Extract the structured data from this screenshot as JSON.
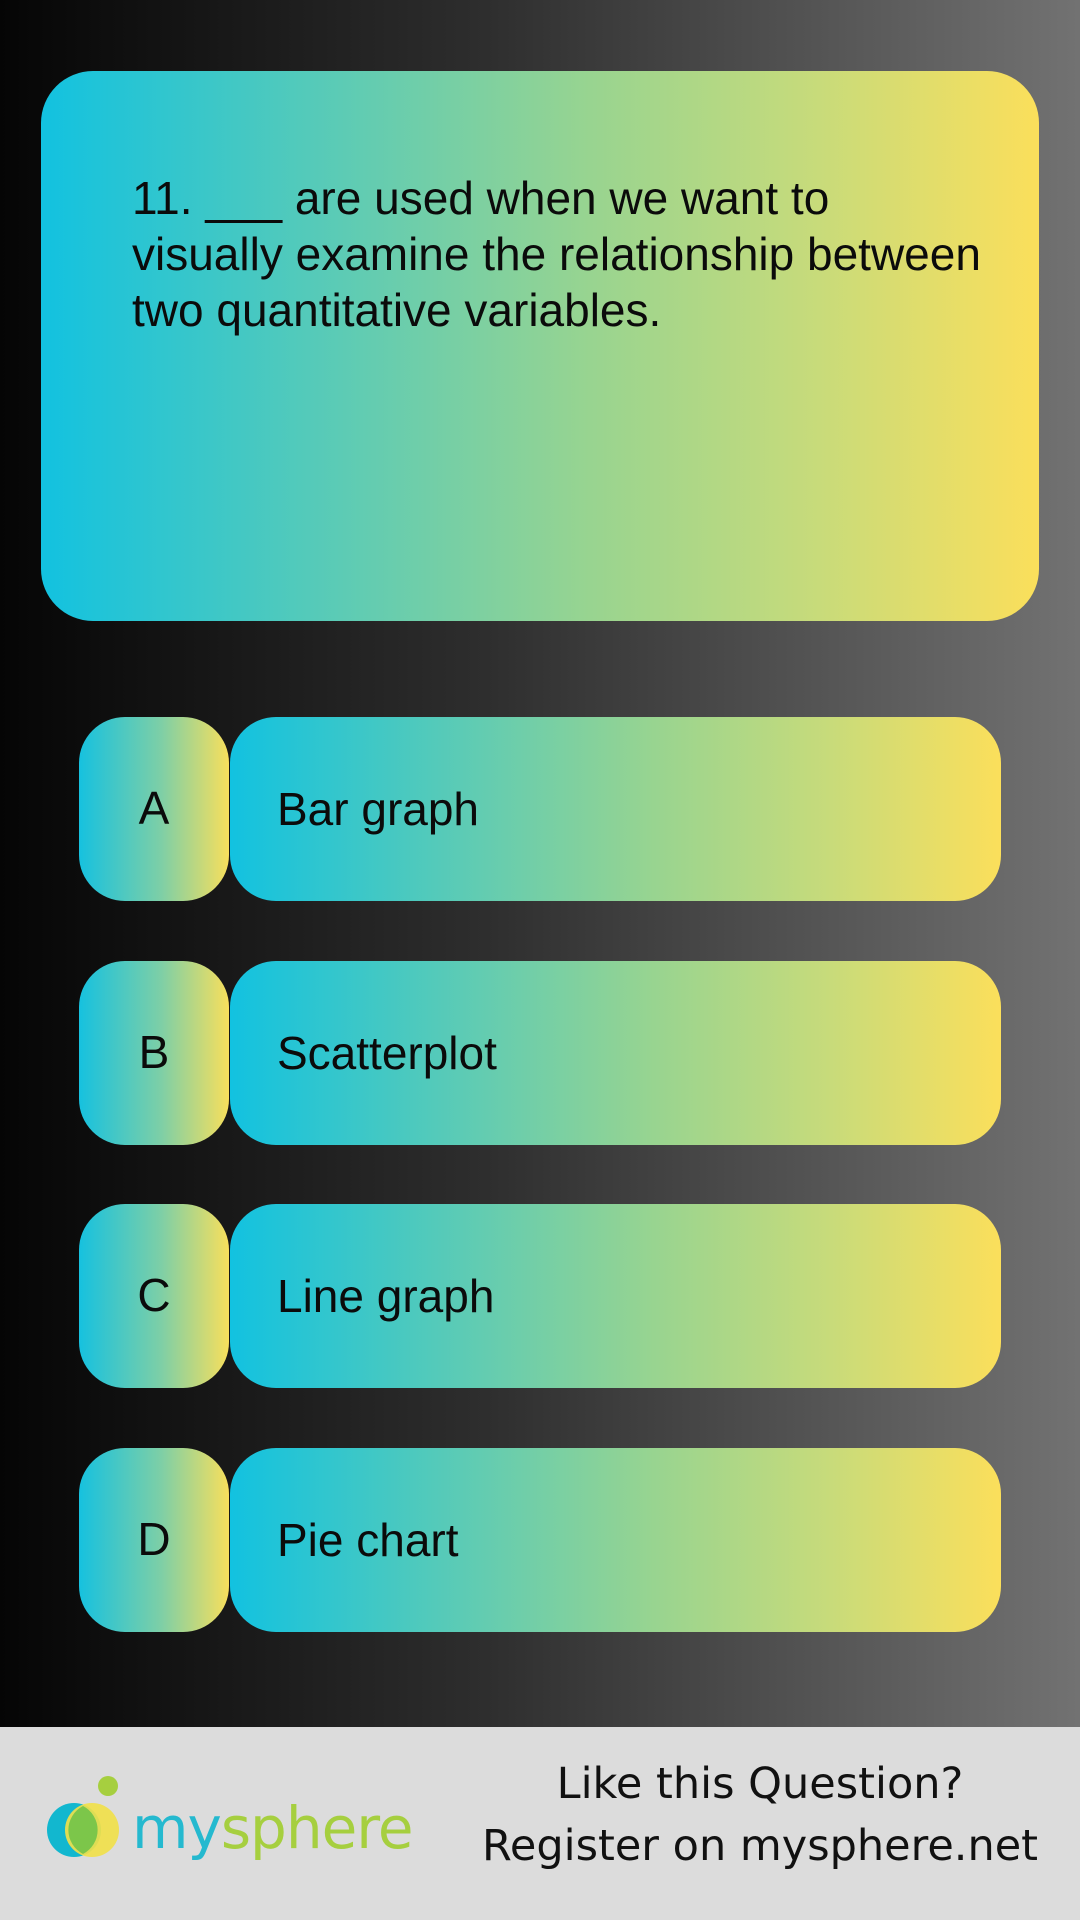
{
  "question": {
    "text": "11. ___ are used when we want to visually examine the relationship between two quantitative variables."
  },
  "options": [
    {
      "letter": "A",
      "label": "Bar graph"
    },
    {
      "letter": "B",
      "label": "Scatterplot"
    },
    {
      "letter": "C",
      "label": "Line graph"
    },
    {
      "letter": "D",
      "label": "Pie chart"
    }
  ],
  "footer": {
    "logo": {
      "part1": "my",
      "part2": "sphere"
    },
    "line1": "Like this Question?",
    "line2": "Register on mysphere.net"
  },
  "colors": {
    "gradient_start": "#12c2e0",
    "gradient_end": "#fbdf5b",
    "logo_blue": "#25b9cf",
    "logo_green": "#a6cf3f",
    "footer_bg": "#dcdcdc"
  }
}
